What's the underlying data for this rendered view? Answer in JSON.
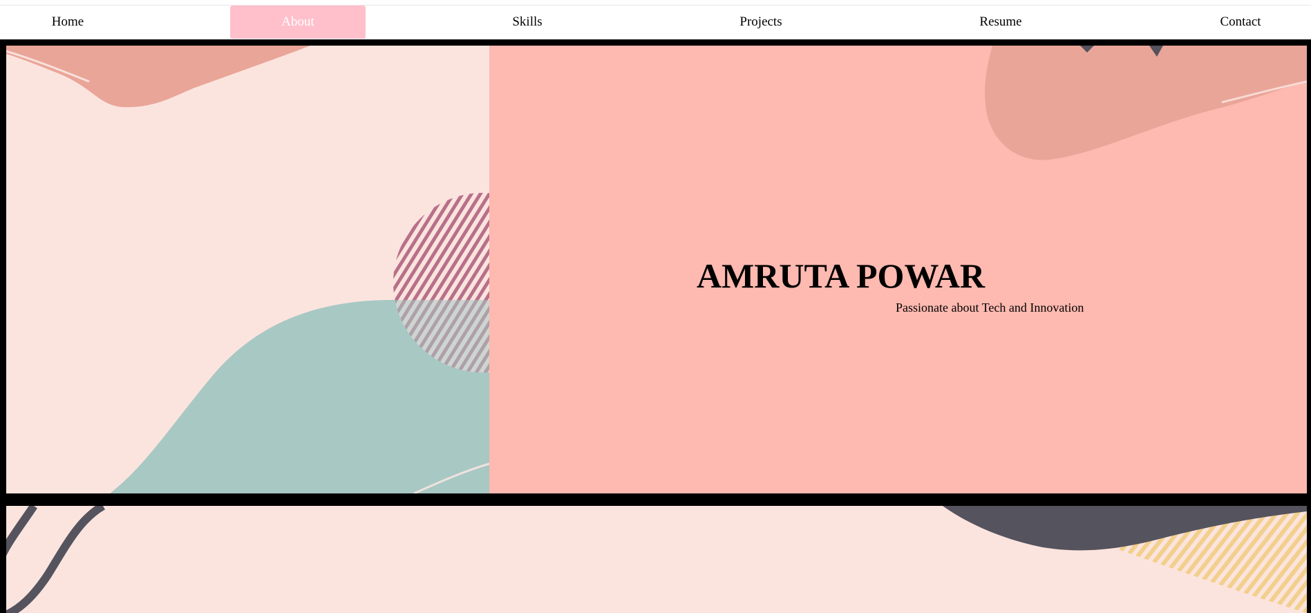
{
  "nav": {
    "items": [
      {
        "label": "Home",
        "active": false
      },
      {
        "label": "About",
        "active": true
      },
      {
        "label": "Skills",
        "active": false
      },
      {
        "label": "Projects",
        "active": false
      },
      {
        "label": "Resume",
        "active": false
      },
      {
        "label": "Contact",
        "active": false
      }
    ],
    "active_color": "#ffc0cb"
  },
  "hero": {
    "name": "AMRUTA POWAR",
    "tagline": "Passionate about Tech and Innovation"
  },
  "colors": {
    "frame": "#000000",
    "left_background": "#fce4de",
    "right_background": "#feb9b0",
    "blob_salmon": "#e9a598",
    "blob_teal": "#a8c8c4",
    "stripe_mauve": "#b7708a",
    "dark_shape": "#55535e",
    "stripe_yellow": "#f2cf8c"
  }
}
